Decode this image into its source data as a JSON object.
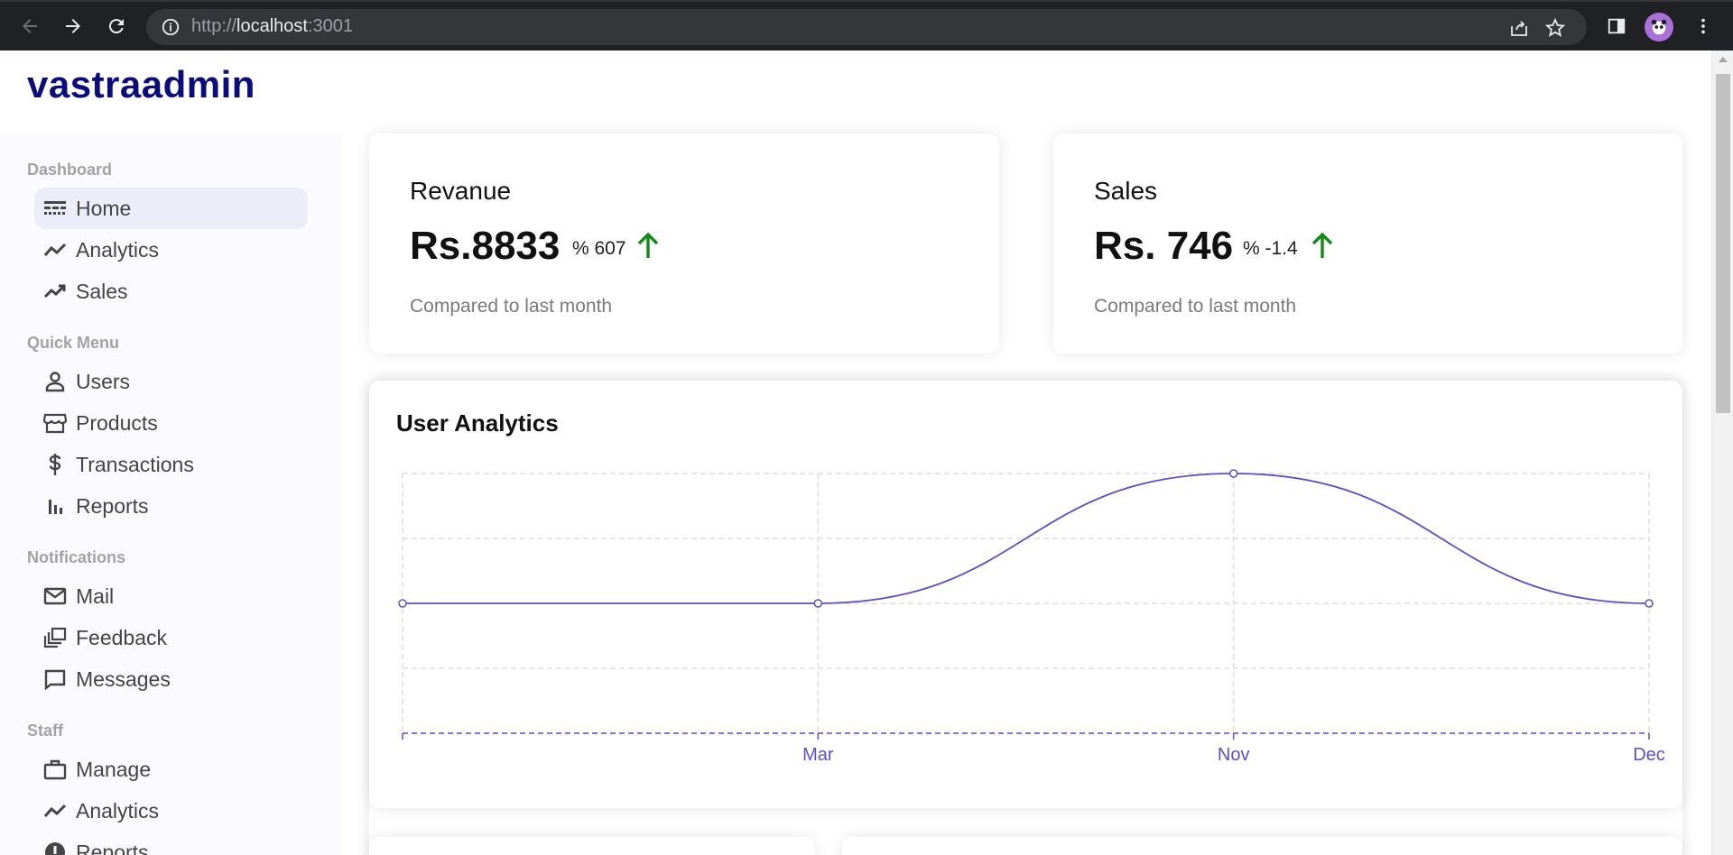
{
  "browser": {
    "url_prefix": "http://",
    "url_host": "localhost",
    "url_suffix": ":3001"
  },
  "app": {
    "logo": "vastraadmin"
  },
  "sidebar": {
    "sections": [
      {
        "title": "Dashboard",
        "items": [
          {
            "label": "Home",
            "icon": "line-style-icon",
            "active": true
          },
          {
            "label": "Analytics",
            "icon": "timeline-icon"
          },
          {
            "label": "Sales",
            "icon": "trending-up-icon"
          }
        ]
      },
      {
        "title": "Quick Menu",
        "items": [
          {
            "label": "Users",
            "icon": "person-icon"
          },
          {
            "label": "Products",
            "icon": "storefront-icon"
          },
          {
            "label": "Transactions",
            "icon": "dollar-icon"
          },
          {
            "label": "Reports",
            "icon": "bar-chart-icon"
          }
        ]
      },
      {
        "title": "Notifications",
        "items": [
          {
            "label": "Mail",
            "icon": "mail-icon"
          },
          {
            "label": "Feedback",
            "icon": "dynamic-feed-icon"
          },
          {
            "label": "Messages",
            "icon": "chat-bubble-icon"
          }
        ]
      },
      {
        "title": "Staff",
        "items": [
          {
            "label": "Manage",
            "icon": "work-icon"
          },
          {
            "label": "Analytics",
            "icon": "timeline-icon"
          },
          {
            "label": "Reports",
            "icon": "report-icon"
          }
        ]
      }
    ]
  },
  "featured": [
    {
      "title": "Revanue",
      "money": "Rs.8833",
      "rate": "% 607",
      "sub": "Compared to last month",
      "arrow_color": "#138a13"
    },
    {
      "title": "Sales",
      "money": "Rs. 746",
      "rate": "% -1.4",
      "sub": "Compared to last month",
      "arrow_color": "#138a13"
    }
  ],
  "chart_data": {
    "type": "line",
    "title": "User Analytics",
    "categories": [
      "",
      "Mar",
      "Nov",
      "Dec"
    ],
    "values": [
      1,
      1,
      2,
      1
    ],
    "ylim": [
      0,
      2
    ],
    "grid": true,
    "color": "#5b50c8"
  }
}
